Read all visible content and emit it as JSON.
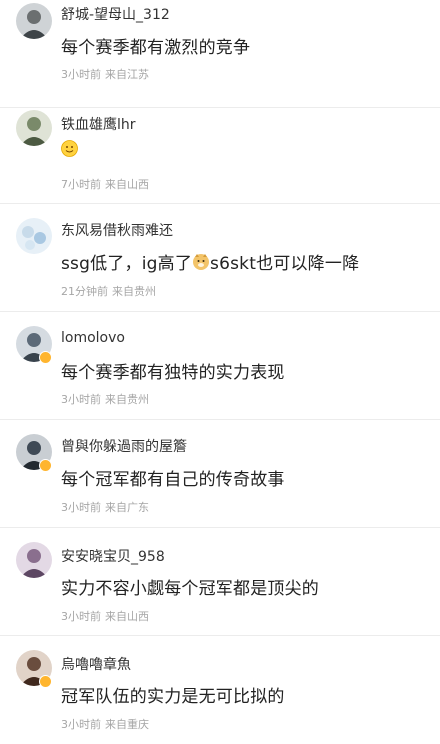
{
  "comments": [
    {
      "username": "舒城-望母山_312",
      "content": "每个赛季都有激烈的竞争",
      "time": "3小时前",
      "location": "来自江苏",
      "avatar_color": "#6b6f70"
    },
    {
      "username": "铁血雄鹰lhr",
      "content_emoji": "smile-emoji",
      "time": "7小时前",
      "location": "来自山西",
      "avatar_color": "#7a8a6a"
    },
    {
      "username": "东风易借秋雨难还",
      "content_before": "ssg低了，ig高了",
      "content_emoji": "doge-emoji",
      "content_after": "s6skt也可以降一降",
      "time": "21分钟前",
      "location": "来自贵州",
      "avatar_color": "#c8dbea"
    },
    {
      "username": "lomolovo",
      "content": "每个赛季都有独特的实力表现",
      "time": "3小时前",
      "location": "来自贵州",
      "avatar_color": "#5c6a78"
    },
    {
      "username": "曾與你躲過雨的屋簷",
      "content": "每个冠军都有自己的传奇故事",
      "time": "3小时前",
      "location": "来自广东",
      "avatar_color": "#3f4a56"
    },
    {
      "username": "安安晓宝贝_958",
      "content": "实力不容小觑每个冠军都是顶尖的",
      "time": "3小时前",
      "location": "来自山西",
      "avatar_color": "#8a6f8e"
    },
    {
      "username": "烏嚕嚕章魚",
      "content": "冠军队伍的实力是无可比拟的",
      "time": "3小时前",
      "location": "来自重庆",
      "avatar_color": "#6a4d3e"
    }
  ],
  "colors": {
    "badge": "#ffb52e",
    "meta": "#a6a6a6",
    "divider": "#ececec"
  }
}
